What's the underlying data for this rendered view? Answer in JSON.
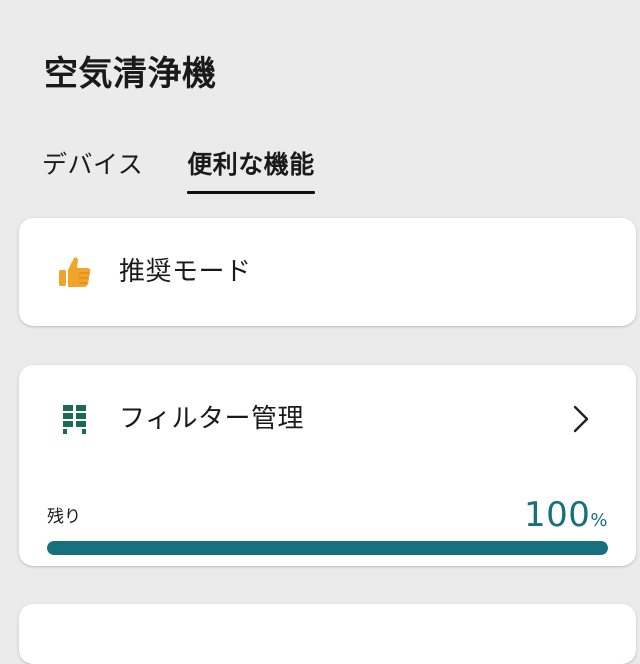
{
  "header": {
    "title": "空気清浄機"
  },
  "tabs": [
    {
      "label": "デバイス",
      "active": false
    },
    {
      "label": "便利な機能",
      "active": true
    }
  ],
  "recommend_card": {
    "icon": "thumbs-up-icon",
    "label": "推奨モード"
  },
  "filter_card": {
    "icon": "filter-grid-icon",
    "label": "フィルター管理",
    "chevron_icon": "chevron-right-icon",
    "remaining_label": "残り",
    "remaining_value": "100",
    "remaining_unit": "%",
    "remaining_fraction": 1.0
  },
  "colors": {
    "background": "#ebebeb",
    "card": "#ffffff",
    "accent": "#16707d",
    "thumb": "#f0a42a"
  }
}
